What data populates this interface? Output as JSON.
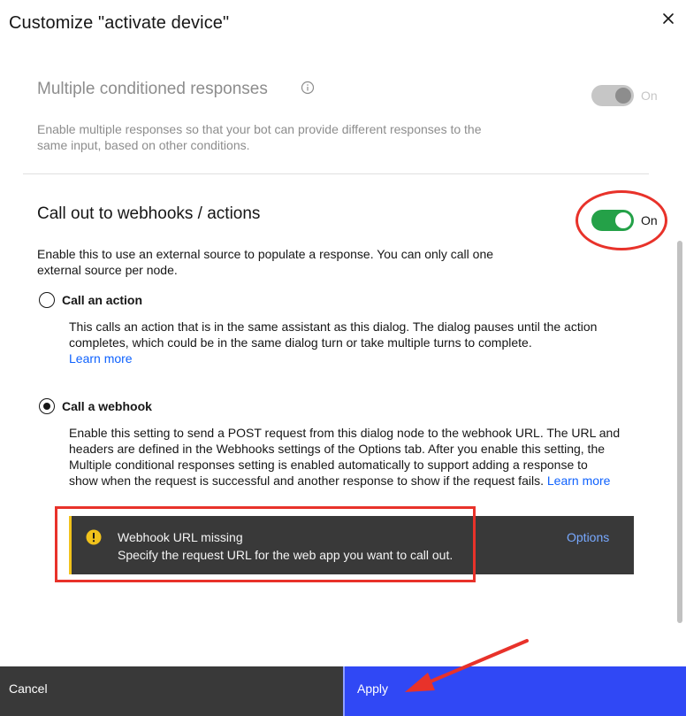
{
  "modal": {
    "title": "Customize \"activate device\""
  },
  "multiple_responses": {
    "title": "Multiple conditioned responses",
    "description_line1": "Enable multiple responses so that your bot can provide different responses to the",
    "description_line2": "same input, based on other conditions.",
    "toggle_label": "On",
    "enabled": true,
    "disabled_state": true
  },
  "webhooks": {
    "title": "Call out to webhooks / actions",
    "description_line1": "Enable this to use an external source to populate a response. You can only call one",
    "description_line2": "external source per node.",
    "toggle_label": "On",
    "enabled": true
  },
  "options": {
    "call_action": {
      "label": "Call an action",
      "selected": false,
      "desc_line1": "This calls an action that is in the same assistant as this dialog. The dialog pauses until the action",
      "desc_line2": "completes, which could be in the same dialog turn or take multiple turns to complete.",
      "link": "Learn more"
    },
    "call_webhook": {
      "label": "Call a webhook",
      "selected": true,
      "desc_line1": "Enable this setting to send a POST request from this dialog node to the webhook URL. The URL and",
      "desc_line2": "headers are defined in the Webhooks settings of the Options tab. After you enable this setting, the",
      "desc_line3": "Multiple conditional responses setting is enabled automatically to support adding a response to",
      "desc_line4": "show when the request is successful and another response to show if the request fails.",
      "link": "Learn more"
    }
  },
  "notification": {
    "title": "Webhook URL missing",
    "subtitle": "Specify the request URL for the web app you want to call out.",
    "action": "Options",
    "icon": "warning-icon"
  },
  "footer": {
    "cancel": "Cancel",
    "apply": "Apply"
  },
  "colors": {
    "toggle_on": "#24a148",
    "toggle_disabled": "#c6c6c6",
    "link": "#0f62fe",
    "apply_button": "#3048f5",
    "cancel_button": "#393939",
    "annotation": "#e8322a",
    "notification_bg": "#393939",
    "warning": "#f1c21b"
  }
}
